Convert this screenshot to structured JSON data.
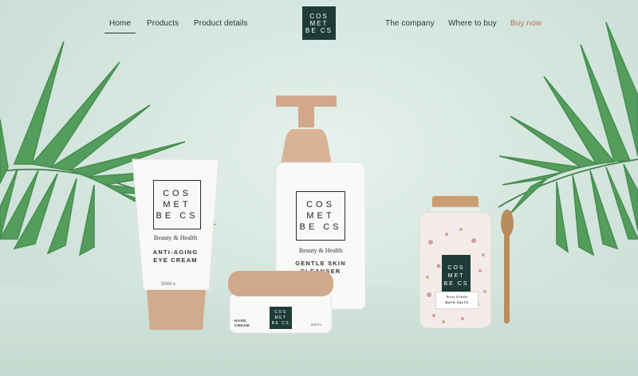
{
  "nav": {
    "left": [
      {
        "label": "Home",
        "active": true
      },
      {
        "label": "Products"
      },
      {
        "label": "Product details"
      }
    ],
    "right": [
      {
        "label": "The company"
      },
      {
        "label": "Where to buy"
      },
      {
        "label": "Buy now",
        "accent": "#c06f58"
      }
    ]
  },
  "logo": {
    "lines": [
      "COS",
      "MET",
      "BE CS"
    ]
  },
  "brand_mark": {
    "lines": [
      "COS",
      "MET",
      "BE CS"
    ]
  },
  "products": {
    "tube": {
      "tagline": "Beauty & Health",
      "name_line1": "ANTI-AGING",
      "name_line2": "EYE CREAM",
      "volume": "50ml ℮"
    },
    "bottle": {
      "tagline": "Beauty & Health",
      "name_line1": "GENTLE SKIN",
      "name_line2": "CLEANSER"
    },
    "jar": {
      "name_line1": "HAND",
      "name_line2": "CREAM",
      "volume": "50ml ℮"
    },
    "salts": {
      "tagline": "Beauty & Health",
      "name": "BATH SALTS"
    }
  },
  "colors": {
    "accent": "#c06f58",
    "brand_dark": "#1e3b37",
    "packaging_tan": "#d0a88a",
    "background": "#d6e7df"
  }
}
